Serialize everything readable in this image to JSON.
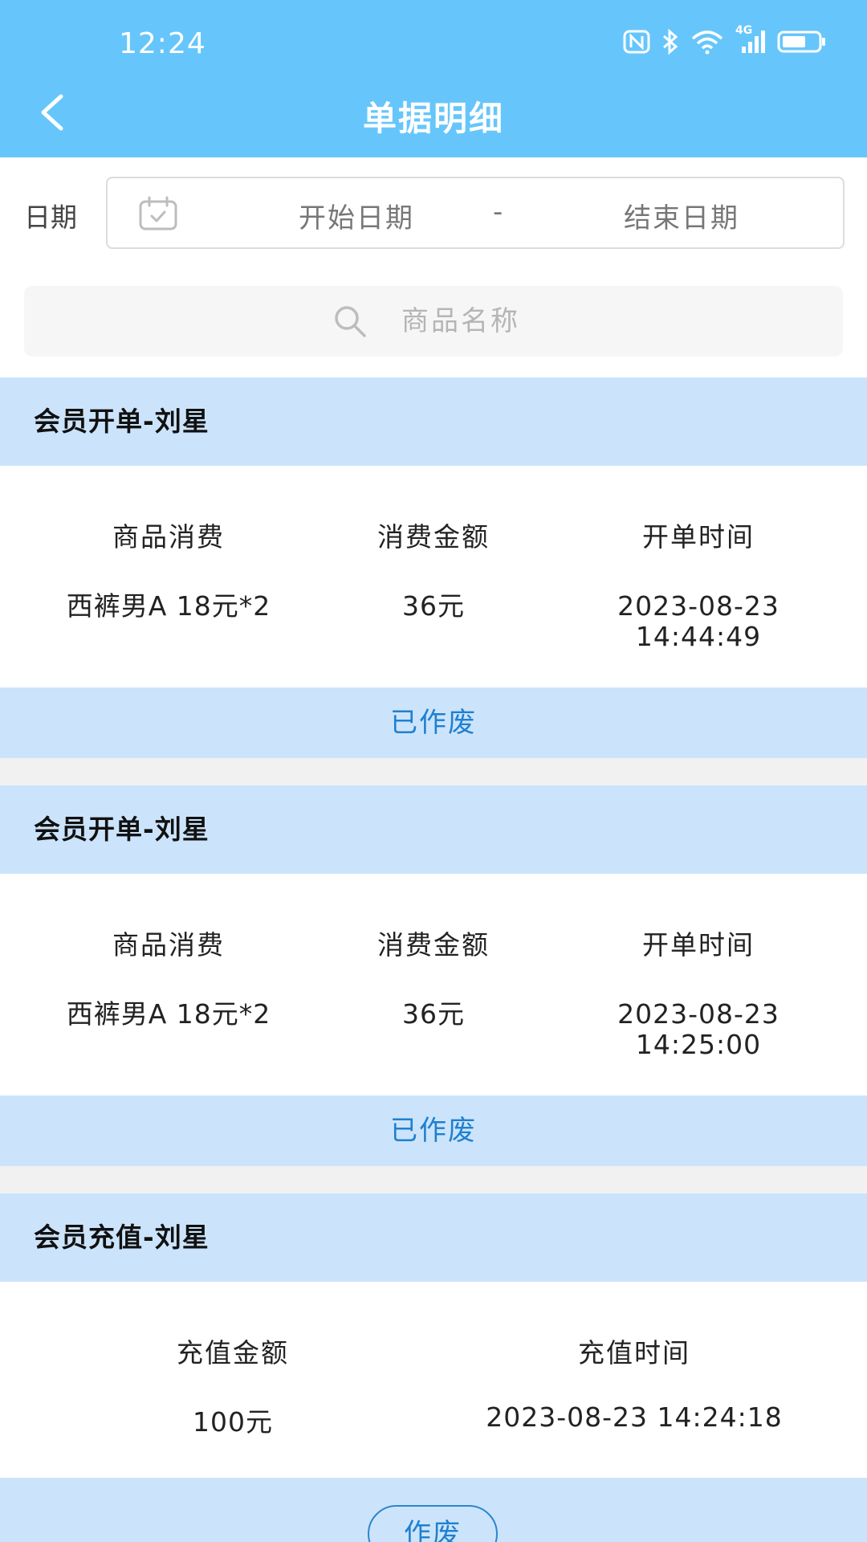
{
  "status_bar": {
    "time": "12:24",
    "network_label": "4G",
    "icons": [
      "nfc-icon",
      "bluetooth-icon",
      "wifi-icon",
      "signal-icon",
      "battery-icon"
    ]
  },
  "nav": {
    "title": "单据明细",
    "back_icon": "chevron-left-icon"
  },
  "filter": {
    "date_label": "日期",
    "start_placeholder": "开始日期",
    "separator": "-",
    "end_placeholder": "结束日期",
    "search_placeholder": "商品名称"
  },
  "records": [
    {
      "title": "会员开单-刘星",
      "headers": [
        "商品消费",
        "消费金额",
        "开单时间"
      ],
      "values": [
        "西裤男A 18元*2",
        "36元",
        "2023-08-23",
        "14:44:49"
      ],
      "status": "已作废"
    },
    {
      "title": "会员开单-刘星",
      "headers": [
        "商品消费",
        "消费金额",
        "开单时间"
      ],
      "values": [
        "西裤男A 18元*2",
        "36元",
        "2023-08-23",
        "14:25:00"
      ],
      "status": "已作废"
    },
    {
      "title": "会员充值-刘星",
      "headers": [
        "充值金额",
        "充值时间"
      ],
      "values": [
        "100元",
        "2023-08-23 14:24:18"
      ],
      "action": "作废"
    }
  ],
  "colors": {
    "header_bg": "#66c6fb",
    "card_header_bg": "#cce4fb",
    "accent_text": "#1f80d0"
  }
}
